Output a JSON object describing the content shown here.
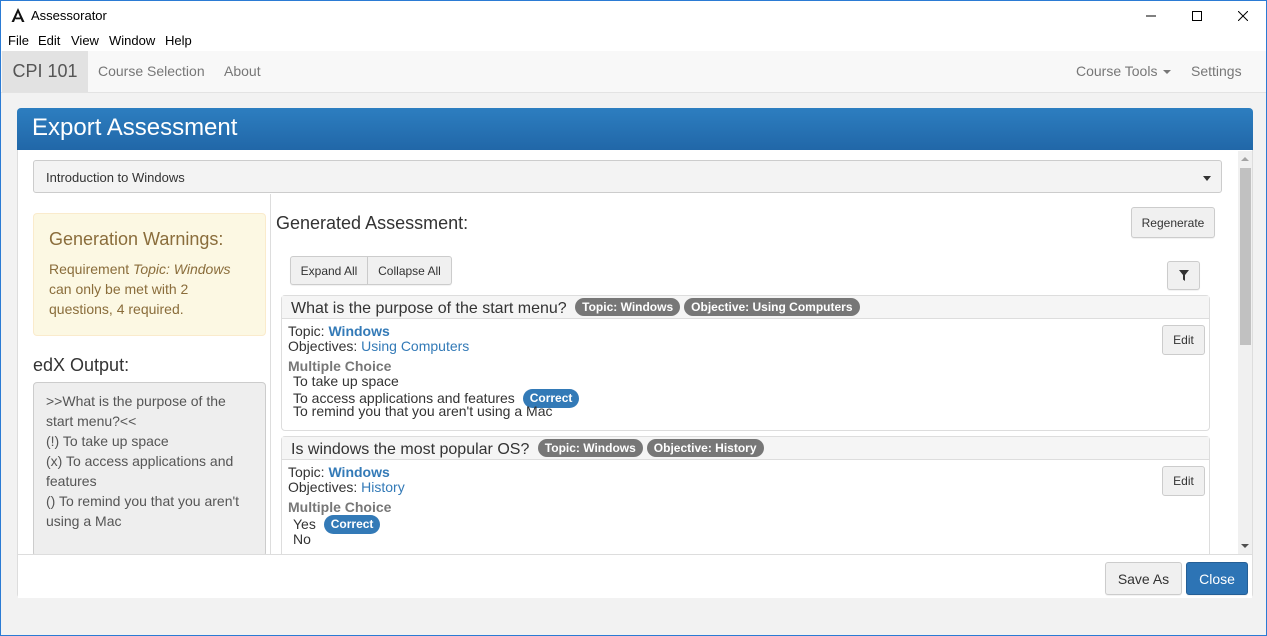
{
  "window": {
    "title": "Assessorator",
    "menu": [
      "File",
      "Edit",
      "View",
      "Window",
      "Help"
    ]
  },
  "navbar": {
    "brand": "CPI 101",
    "links": [
      "Course Selection",
      "About"
    ],
    "right_links": [
      "Course Tools",
      "Settings"
    ]
  },
  "panel": {
    "title": "Export Assessment",
    "dropdown_value": "Introduction to Windows",
    "warnings": {
      "title": "Generation Warnings:",
      "text_before": "Requirement ",
      "text_em": "Topic: Windows",
      "text_after": " can only be met with 2 questions, 4 required."
    },
    "edx": {
      "heading": "edX Output:",
      "lines": [
        ">>What is the purpose of the start menu?<<",
        "(!) To take up space",
        "(x) To access applications and features",
        "() To remind you that you aren't using a Mac"
      ]
    },
    "generated": {
      "heading": "Generated Assessment:",
      "regenerate": "Regenerate",
      "expand_all": "Expand All",
      "collapse_all": "Collapse All"
    },
    "questions": [
      {
        "title": "What is the purpose of the start menu?",
        "topic_badge": "Topic: Windows",
        "objective_badge": "Objective: Using Computers",
        "topic_label": "Topic:",
        "topic": "Windows",
        "objectives_label": "Objectives:",
        "objective": "Using Computers",
        "type": "Multiple Choice",
        "options": [
          "To take up space",
          "To access applications and features",
          "To remind you that you aren't using a Mac"
        ],
        "correct_label": "Correct",
        "edit": "Edit"
      },
      {
        "title": "Is windows the most popular OS?",
        "topic_badge": "Topic: Windows",
        "objective_badge": "Objective: History",
        "topic_label": "Topic:",
        "topic": "Windows",
        "objectives_label": "Objectives:",
        "objective": "History",
        "type": "Multiple Choice",
        "options": [
          "Yes",
          "No"
        ],
        "correct_label": "Correct",
        "edit": "Edit"
      }
    ],
    "footer": {
      "save_as": "Save As",
      "close": "Close"
    }
  },
  "colors": {
    "primary": "#337ab7",
    "header_blue": "#2167a8",
    "warning_bg": "#fcf8e3",
    "badge_gray": "#777777"
  }
}
